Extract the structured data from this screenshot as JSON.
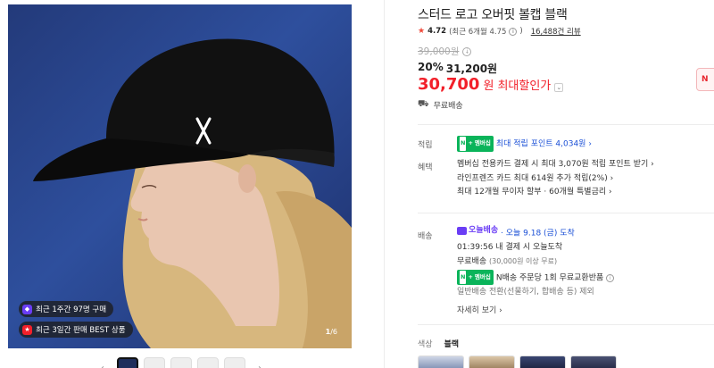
{
  "product": {
    "title": "스터드 로고 오버핏 볼캡 블랙",
    "rating": "4.72",
    "rating_recent": "(최근 6개월 4.75",
    "rating_recent_close": ")",
    "reviews": "16,488건 리뷰",
    "original_price": "39,000원",
    "discount_rate": "20%",
    "sale_price": "31,200원",
    "best_price": "30,700",
    "best_won": "원",
    "best_label": "최대할인가",
    "shipping_free": "무료배송"
  },
  "image": {
    "badge1": "최근 1주간 97명 구매",
    "badge2": "최근 3일간 판매 BEST 상품",
    "counter_current": "1",
    "counter_total": "/6"
  },
  "points": {
    "label": "적립",
    "pill_n": "N",
    "pill_plus": "+",
    "pill_member": "멤버십",
    "text": "최대 적립 포인트 4,034원",
    "chev": "›"
  },
  "benefits": {
    "label": "혜택",
    "lines": [
      "멤버십 전용카드 결제 시 최대 3,070원 적립 포인트 받기 ›",
      "라인프렌즈 카드 최대 614원 추가 적립(2%) ›",
      "최대 12개월 무이자 할부 · 60개월 특별금리 ›"
    ]
  },
  "delivery": {
    "label": "배송",
    "today_label": "오늘배송",
    "today_date": "· 오늘 9.18 (금) 도착",
    "countdown": "01:39:56",
    "countdown_text": "내 결제 시 오늘도착",
    "free_label": "무료배송",
    "free_cond": "(30,000원 이상 무료)",
    "nship": "N배송 주문당 1회 무료교환반품",
    "general": "일반배송 전환(선물하기, 합배송 등) 제외",
    "more": "자세히 보기 ›"
  },
  "options": {
    "color_label": "색상",
    "color_value": "블랙"
  },
  "side_button": "N",
  "colors": {
    "accent_red": "#f2202a",
    "naver_green": "#0ab45a",
    "today_purple": "#6a3df5"
  }
}
